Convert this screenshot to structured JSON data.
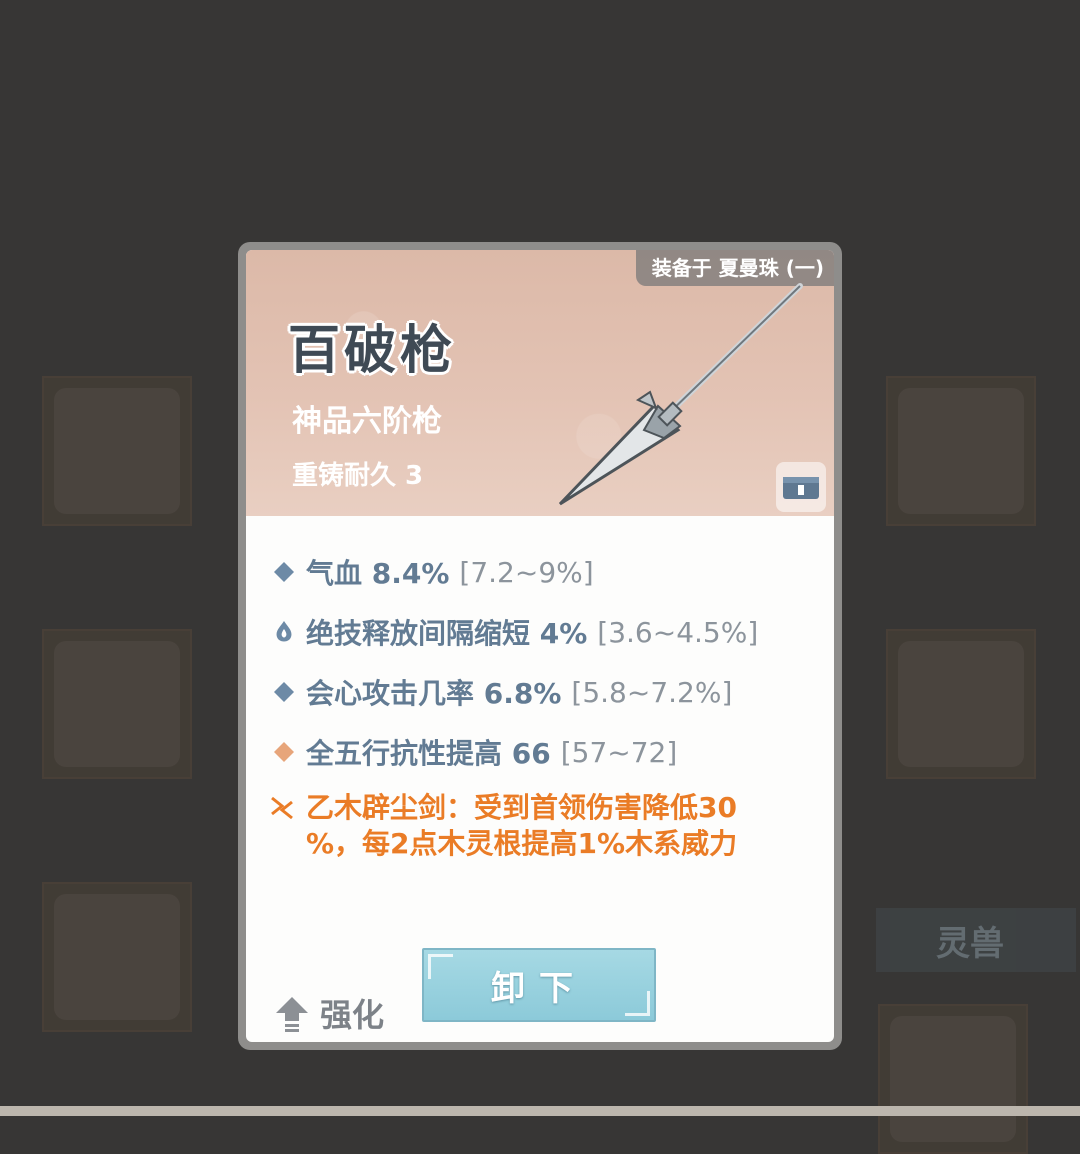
{
  "background": {
    "side_tab_label": "灵兽"
  },
  "item": {
    "equipped_to": "装备于 夏曼珠 (一)",
    "name": "百破枪",
    "grade": "神品六阶枪",
    "durability": "重铸耐久 3"
  },
  "stats": [
    {
      "icon": "blue-diamond-icon",
      "label": "气血 8.4%",
      "range": "[7.2~9%]"
    },
    {
      "icon": "flame-drop-icon",
      "label": "绝技释放间隔缩短 4%",
      "range": "[3.6~4.5%]"
    },
    {
      "icon": "blue-diamond-icon",
      "label": "会心攻击几率 6.8%",
      "range": "[5.8~7.2%]"
    },
    {
      "icon": "orange-diamond-icon",
      "label": "全五行抗性提高 66",
      "range": "[57~72]"
    }
  ],
  "special_effect": {
    "icon": "crossed-zigzag-icon",
    "line1": "乙木辟尘剑：受到首领伤害降低30",
    "line2": "%，每2点木灵根提高1%木系威力"
  },
  "actions": {
    "upgrade_label": "强化",
    "unequip_label": "卸下"
  },
  "colors": {
    "stat_text": "#627b93",
    "special_text": "#ea7c26",
    "button": "#9dd3e0"
  }
}
